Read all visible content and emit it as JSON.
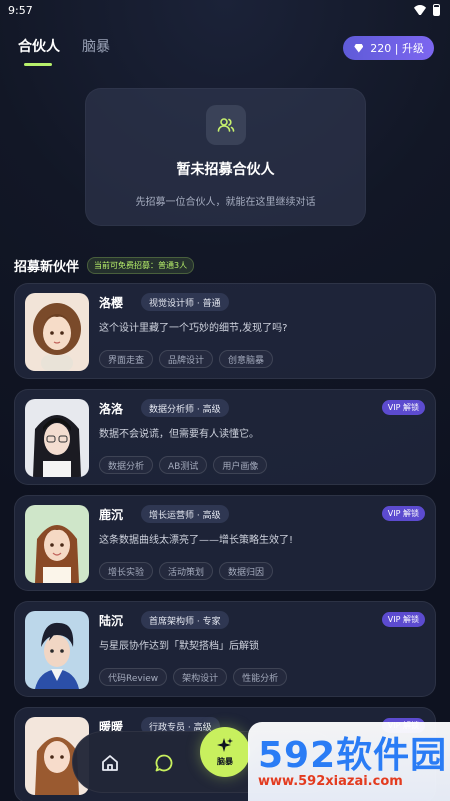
{
  "status": {
    "time": "9:57"
  },
  "header": {
    "tabs": [
      {
        "label": "合伙人",
        "active": true
      },
      {
        "label": "脑暴",
        "active": false
      }
    ],
    "credits": "220 | 升级"
  },
  "empty_state": {
    "title": "暂未招募合伙人",
    "subtitle": "先招募一位合伙人，就能在这里继续对话"
  },
  "section": {
    "title": "招募新伙伴",
    "badge": "当前可免费招募：普通3人"
  },
  "partners": [
    {
      "name": "洛樱",
      "role": "视觉设计师 · 普通",
      "vip": "",
      "desc": "这个设计里藏了一个巧妙的细节,发现了吗?",
      "tags": [
        "界面走查",
        "品牌设计",
        "创意脑暴"
      ]
    },
    {
      "name": "洛洛",
      "role": "数据分析师 · 高级",
      "vip": "VIP 解锁",
      "desc": "数据不会说谎，但需要有人读懂它。",
      "tags": [
        "数据分析",
        "AB测试",
        "用户画像"
      ]
    },
    {
      "name": "鹿沉",
      "role": "增长运营师 · 高级",
      "vip": "VIP 解锁",
      "desc": "这条数据曲线太漂亮了——增长策略生效了!",
      "tags": [
        "增长实验",
        "活动策划",
        "数据归因"
      ]
    },
    {
      "name": "陆沉",
      "role": "首席架构师 · 专家",
      "vip": "VIP 解锁",
      "desc": "与星辰协作达到「默契搭档」后解锁",
      "tags": [
        "代码Review",
        "架构设计",
        "性能分析"
      ]
    },
    {
      "name": "暖暖",
      "role": "行政专员 · 高级",
      "vip": "VIP 解锁",
      "desc": "",
      "tags": []
    }
  ],
  "nav": {
    "fab_label": "脑暴"
  },
  "watermark": {
    "brand_digits": "592",
    "brand_text": "软件园",
    "url": "www.592xiazai.com"
  },
  "colors": {
    "accent": "#b7f06b",
    "vip": "#5c4bcf",
    "fab": "#c8f05e"
  }
}
